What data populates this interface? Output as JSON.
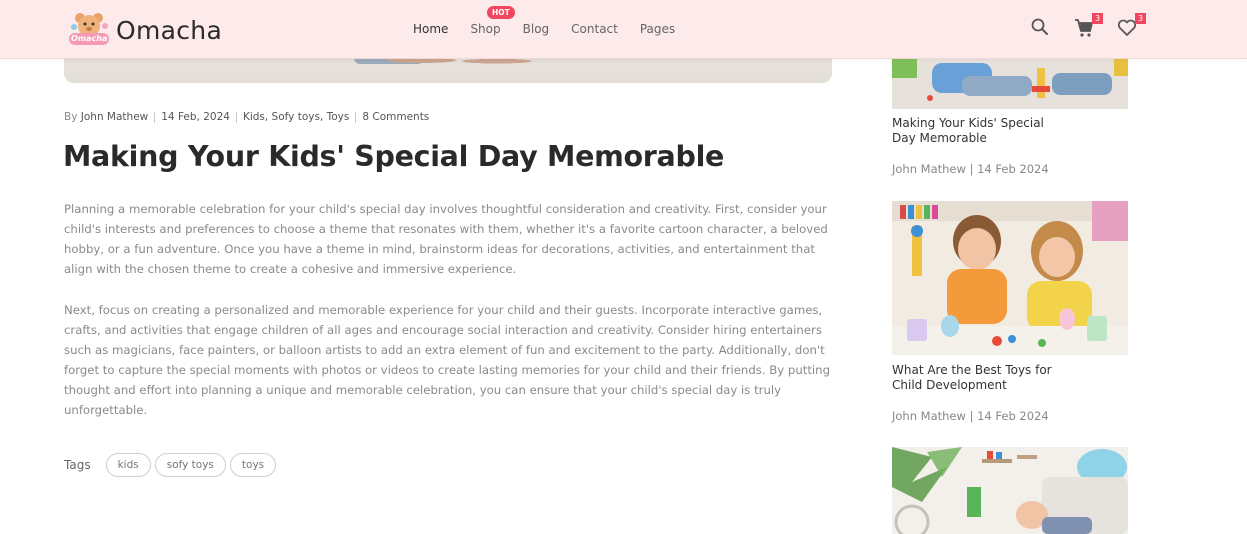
{
  "brand": {
    "name": "Omacha",
    "logo_text": "Omacha"
  },
  "nav": {
    "items": [
      {
        "label": "Home"
      },
      {
        "label": "Shop"
      },
      {
        "label": "Blog"
      },
      {
        "label": "Contact"
      },
      {
        "label": "Pages"
      }
    ],
    "active": "Home",
    "shop_badge": "HOT"
  },
  "header_icons": {
    "search": "search-icon",
    "cart": {
      "icon": "cart-icon",
      "count": "3"
    },
    "wishlist": {
      "icon": "heart-icon",
      "count": "3"
    }
  },
  "article": {
    "meta": {
      "by_prefix": "By",
      "author": "John Mathew",
      "date": "14 Feb, 2024",
      "categories": "Kids, Sofy toys, Toys",
      "comments": "8 Comments"
    },
    "title": "Making Your Kids' Special Day Memorable",
    "paragraphs": [
      "Planning a memorable celebration for your child's special day involves thoughtful consideration and creativity. First, consider your child's interests and preferences to choose a theme that resonates with them, whether it's a favorite cartoon character, a beloved hobby, or a fun adventure. Once you have a theme in mind, brainstorm ideas for decorations, activities, and entertainment that align with the chosen theme to create a cohesive and immersive experience.",
      "Next, focus on creating a personalized and memorable experience for your child and their guests. Incorporate interactive games, crafts, and activities that engage children of all ages and encourage social interaction and creativity. Consider hiring entertainers such as magicians, face painters, or balloon artists to add an extra element of fun and excitement to the party. Additionally, don't forget to capture the special moments with photos or videos to create lasting memories for your child and their friends. By putting thought and effort into planning a unique and memorable celebration, you can ensure that your child's special day is truly unforgettable."
    ],
    "tags_label": "Tags",
    "tags": [
      "kids",
      "sofy toys",
      "toys"
    ]
  },
  "sidebar": {
    "posts": [
      {
        "title": "Making Your Kids' Special Day Memorable",
        "meta": "John Mathew | 14 Feb 2024"
      },
      {
        "title": "What Are the Best Toys for Child Development",
        "meta": "John Mathew | 14 Feb 2024"
      }
    ]
  },
  "colors": {
    "header_bg": "#fdeaea",
    "accent": "#f0465f",
    "title_text": "#2a2a2a",
    "body_text": "#8a8a8a"
  }
}
